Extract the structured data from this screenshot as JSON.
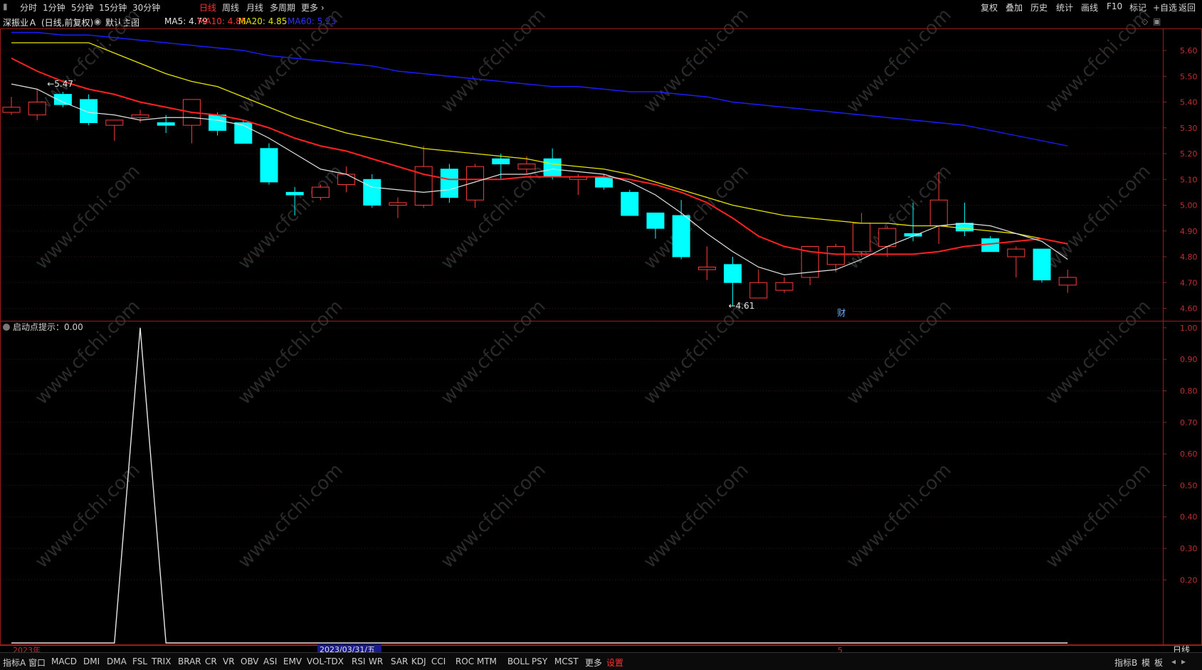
{
  "toolbar": {
    "periods": [
      "分时",
      "1分钟",
      "5分钟",
      "15分钟",
      "30分钟",
      "日线",
      "周线",
      "月线",
      "多周期",
      "更多 ›"
    ],
    "active_period": "日线",
    "right_buttons": [
      "复权",
      "叠加",
      "历史",
      "统计",
      "画线",
      "F10",
      "标记",
      "+自选",
      "返回"
    ]
  },
  "info": {
    "stock_name": "深振业Ａ",
    "mode": "(日线,前复权)",
    "main_indicator": "默认主图",
    "ma5": "MA5: 4.79",
    "ma10": "MA10: 4.85",
    "ma20": "MA20: 4.85",
    "ma60": "MA60: 5.23"
  },
  "colors": {
    "up": "#ff3b3b",
    "down": "#00ffff",
    "ma5": "#e0e0e0",
    "ma10": "#ff2020",
    "ma20": "#e6e600",
    "ma60": "#1c1cff",
    "axis": "#9b1c1c"
  },
  "chart_data": [
    {
      "type": "candlestick",
      "yticks": [
        "5.60",
        "5.50",
        "5.40",
        "5.30",
        "5.20",
        "5.10",
        "5.00",
        "4.90",
        "4.80",
        "4.70",
        "4.60"
      ],
      "ylim": [
        4.56,
        5.68
      ],
      "candles": [
        {
          "o": 5.36,
          "h": 5.42,
          "l": 5.35,
          "c": 5.38
        },
        {
          "o": 5.35,
          "h": 5.45,
          "l": 5.33,
          "c": 5.4
        },
        {
          "o": 5.43,
          "h": 5.44,
          "l": 5.38,
          "c": 5.39
        },
        {
          "o": 5.41,
          "h": 5.43,
          "l": 5.31,
          "c": 5.32
        },
        {
          "o": 5.31,
          "h": 5.33,
          "l": 5.25,
          "c": 5.33
        },
        {
          "o": 5.34,
          "h": 5.37,
          "l": 5.32,
          "c": 5.35
        },
        {
          "o": 5.32,
          "h": 5.35,
          "l": 5.28,
          "c": 5.31
        },
        {
          "o": 5.31,
          "h": 5.36,
          "l": 5.24,
          "c": 5.41
        },
        {
          "o": 5.35,
          "h": 5.36,
          "l": 5.27,
          "c": 5.29
        },
        {
          "o": 5.32,
          "h": 5.33,
          "l": 5.24,
          "c": 5.24
        },
        {
          "o": 5.22,
          "h": 5.24,
          "l": 5.08,
          "c": 5.09
        },
        {
          "o": 5.05,
          "h": 5.07,
          "l": 4.96,
          "c": 5.04
        },
        {
          "o": 5.03,
          "h": 5.08,
          "l": 5.02,
          "c": 5.07
        },
        {
          "o": 5.08,
          "h": 5.15,
          "l": 5.05,
          "c": 5.12
        },
        {
          "o": 5.1,
          "h": 5.12,
          "l": 4.99,
          "c": 5.0
        },
        {
          "o": 5.0,
          "h": 5.03,
          "l": 4.95,
          "c": 5.01
        },
        {
          "o": 5.0,
          "h": 5.23,
          "l": 4.99,
          "c": 5.15
        },
        {
          "o": 5.14,
          "h": 5.16,
          "l": 5.01,
          "c": 5.03
        },
        {
          "o": 5.02,
          "h": 5.16,
          "l": 4.99,
          "c": 5.15
        },
        {
          "o": 5.18,
          "h": 5.2,
          "l": 5.1,
          "c": 5.16
        },
        {
          "o": 5.14,
          "h": 5.19,
          "l": 5.12,
          "c": 5.16
        },
        {
          "o": 5.18,
          "h": 5.22,
          "l": 5.1,
          "c": 5.11
        },
        {
          "o": 5.1,
          "h": 5.12,
          "l": 5.04,
          "c": 5.11
        },
        {
          "o": 5.11,
          "h": 5.12,
          "l": 5.06,
          "c": 5.07
        },
        {
          "o": 5.05,
          "h": 5.06,
          "l": 4.96,
          "c": 4.96
        },
        {
          "o": 4.97,
          "h": 4.97,
          "l": 4.87,
          "c": 4.91
        },
        {
          "o": 4.96,
          "h": 5.02,
          "l": 4.79,
          "c": 4.8
        },
        {
          "o": 4.75,
          "h": 4.84,
          "l": 4.71,
          "c": 4.76
        },
        {
          "o": 4.77,
          "h": 4.8,
          "l": 4.61,
          "c": 4.7
        },
        {
          "o": 4.64,
          "h": 4.75,
          "l": 4.64,
          "c": 4.7
        },
        {
          "o": 4.67,
          "h": 4.72,
          "l": 4.66,
          "c": 4.7
        },
        {
          "o": 4.72,
          "h": 4.84,
          "l": 4.69,
          "c": 4.84
        },
        {
          "o": 4.77,
          "h": 4.85,
          "l": 4.74,
          "c": 4.84
        },
        {
          "o": 4.82,
          "h": 4.97,
          "l": 4.8,
          "c": 4.93
        },
        {
          "o": 4.84,
          "h": 4.92,
          "l": 4.8,
          "c": 4.91
        },
        {
          "o": 4.89,
          "h": 5.01,
          "l": 4.86,
          "c": 4.88
        },
        {
          "o": 4.92,
          "h": 5.13,
          "l": 4.85,
          "c": 5.02
        },
        {
          "o": 4.93,
          "h": 5.01,
          "l": 4.88,
          "c": 4.9
        },
        {
          "o": 4.87,
          "h": 4.88,
          "l": 4.82,
          "c": 4.82
        },
        {
          "o": 4.8,
          "h": 4.84,
          "l": 4.72,
          "c": 4.83
        },
        {
          "o": 4.83,
          "h": 4.83,
          "l": 4.7,
          "c": 4.71
        },
        {
          "o": 4.69,
          "h": 4.75,
          "l": 4.66,
          "c": 4.72
        }
      ],
      "ma5": [
        5.47,
        5.45,
        5.4,
        5.36,
        5.35,
        5.33,
        5.34,
        5.34,
        5.33,
        5.31,
        5.26,
        5.2,
        5.14,
        5.12,
        5.07,
        5.06,
        5.05,
        5.06,
        5.09,
        5.12,
        5.12,
        5.14,
        5.13,
        5.12,
        5.09,
        5.04,
        4.97,
        4.89,
        4.82,
        4.76,
        4.73,
        4.74,
        4.75,
        4.79,
        4.84,
        4.88,
        4.92,
        4.93,
        4.92,
        4.89,
        4.86,
        4.79
      ],
      "ma10": [
        5.57,
        5.52,
        5.48,
        5.45,
        5.43,
        5.4,
        5.38,
        5.36,
        5.35,
        5.33,
        5.3,
        5.26,
        5.23,
        5.21,
        5.18,
        5.15,
        5.12,
        5.1,
        5.1,
        5.1,
        5.11,
        5.11,
        5.11,
        5.11,
        5.1,
        5.08,
        5.05,
        5.01,
        4.95,
        4.88,
        4.84,
        4.82,
        4.81,
        4.81,
        4.81,
        4.81,
        4.82,
        4.84,
        4.85,
        4.86,
        4.87,
        4.85
      ],
      "ma20": [
        5.63,
        5.63,
        5.63,
        5.63,
        5.59,
        5.55,
        5.51,
        5.48,
        5.46,
        5.42,
        5.38,
        5.34,
        5.31,
        5.28,
        5.26,
        5.24,
        5.22,
        5.21,
        5.2,
        5.19,
        5.18,
        5.16,
        5.15,
        5.14,
        5.12,
        5.09,
        5.06,
        5.03,
        5.0,
        4.98,
        4.96,
        4.95,
        4.94,
        4.93,
        4.93,
        4.92,
        4.92,
        4.91,
        4.9,
        4.89,
        4.87,
        4.85
      ],
      "ma60": [
        5.67,
        5.67,
        5.66,
        5.66,
        5.65,
        5.64,
        5.63,
        5.62,
        5.61,
        5.6,
        5.58,
        5.57,
        5.56,
        5.55,
        5.54,
        5.52,
        5.51,
        5.5,
        5.49,
        5.48,
        5.47,
        5.46,
        5.46,
        5.45,
        5.44,
        5.44,
        5.43,
        5.42,
        5.4,
        5.39,
        5.38,
        5.37,
        5.36,
        5.35,
        5.34,
        5.33,
        5.32,
        5.31,
        5.29,
        5.27,
        5.25,
        5.23
      ],
      "annotations": [
        {
          "label": "5.47",
          "index": 1,
          "price": 5.47
        },
        {
          "label": "4.61",
          "index": 28,
          "price": 4.61
        },
        {
          "label": "财",
          "index": 32
        }
      ]
    },
    {
      "type": "line",
      "title": "启动点提示：0.00",
      "yticks": [
        "1.00",
        "0.90",
        "0.80",
        "0.70",
        "0.60",
        "0.50",
        "0.40",
        "0.30",
        "0.20"
      ],
      "ylim": [
        0,
        1.02
      ],
      "values": [
        0,
        0,
        0,
        0,
        0,
        1,
        0,
        0,
        0,
        0,
        0,
        0,
        0,
        0,
        0,
        0,
        0,
        0,
        0,
        0,
        0,
        0,
        0,
        0,
        0,
        0,
        0,
        0,
        0,
        0,
        0,
        0,
        0,
        0,
        0,
        0,
        0,
        0,
        0,
        0,
        0,
        0
      ]
    }
  ],
  "xaxis": {
    "year_label": "2023年",
    "cursor_date": "2023/03/31/五",
    "month_label": "5",
    "period_label": "日线"
  },
  "watermark": "www.cfchi.com",
  "bottom_tabs": [
    "指标A",
    "窗口",
    "MACD",
    "DMI",
    "DMA",
    "FSL",
    "TRIX",
    "BRAR",
    "CR",
    "VR",
    "OBV",
    "ASI",
    "EMV",
    "VOL-TDX",
    "RSI",
    "WR",
    "SAR",
    "KDJ",
    "CCI",
    "ROC",
    "MTM",
    "BOLL",
    "PSY",
    "MCST",
    "更多",
    "设置"
  ],
  "bottom_right": [
    "指标B",
    "模",
    "板"
  ]
}
